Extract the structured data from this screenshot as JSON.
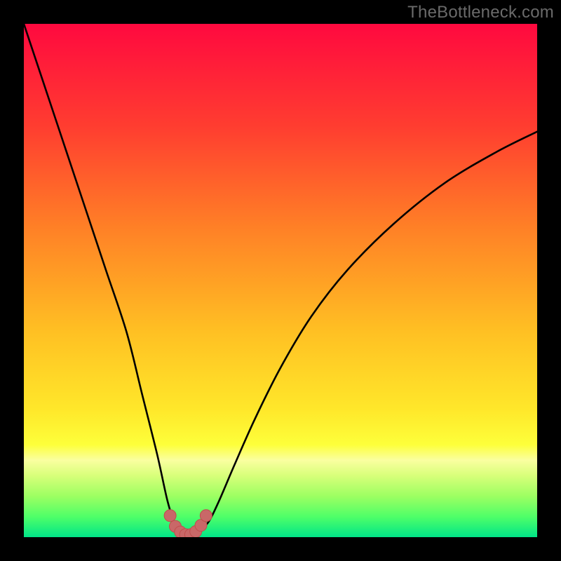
{
  "watermark": "TheBottleneck.com",
  "colors": {
    "frame": "#000000",
    "watermark": "#6a6a6a",
    "curve_stroke": "#000000",
    "marker_fill": "#c96868",
    "marker_stroke": "#c04d4d",
    "gradient_stops": [
      {
        "offset": 0.0,
        "color": "#ff093f"
      },
      {
        "offset": 0.2,
        "color": "#ff3d30"
      },
      {
        "offset": 0.4,
        "color": "#ff8126"
      },
      {
        "offset": 0.6,
        "color": "#ffc023"
      },
      {
        "offset": 0.75,
        "color": "#ffe72a"
      },
      {
        "offset": 0.82,
        "color": "#fdff3a"
      },
      {
        "offset": 0.85,
        "color": "#faffa0"
      },
      {
        "offset": 0.88,
        "color": "#d8ff7a"
      },
      {
        "offset": 0.92,
        "color": "#9dff62"
      },
      {
        "offset": 0.96,
        "color": "#4fff68"
      },
      {
        "offset": 1.0,
        "color": "#00e588"
      }
    ]
  },
  "chart_data": {
    "type": "line",
    "title": "",
    "xlabel": "",
    "ylabel": "",
    "xlim": [
      0,
      100
    ],
    "ylim": [
      0,
      100
    ],
    "grid": false,
    "series": [
      {
        "name": "bottleneck-curve",
        "x": [
          0,
          4,
          8,
          12,
          16,
          20,
          23,
          26,
          28,
          29.5,
          31,
          32,
          33,
          34,
          36,
          38,
          41,
          45,
          50,
          56,
          63,
          72,
          82,
          92,
          100
        ],
        "y": [
          100,
          88,
          76,
          64,
          52,
          40,
          28,
          16,
          7,
          2.5,
          1,
          0.5,
          0.5,
          1,
          3,
          7,
          14,
          23,
          33,
          43,
          52,
          61,
          69,
          75,
          79
        ]
      }
    ],
    "markers": {
      "name": "minimum-region",
      "x": [
        28.5,
        29.5,
        30.5,
        31.5,
        32.5,
        33.5,
        34.5,
        35.5
      ],
      "y": [
        4.2,
        2.1,
        1.0,
        0.5,
        0.5,
        1.1,
        2.3,
        4.2
      ]
    }
  }
}
